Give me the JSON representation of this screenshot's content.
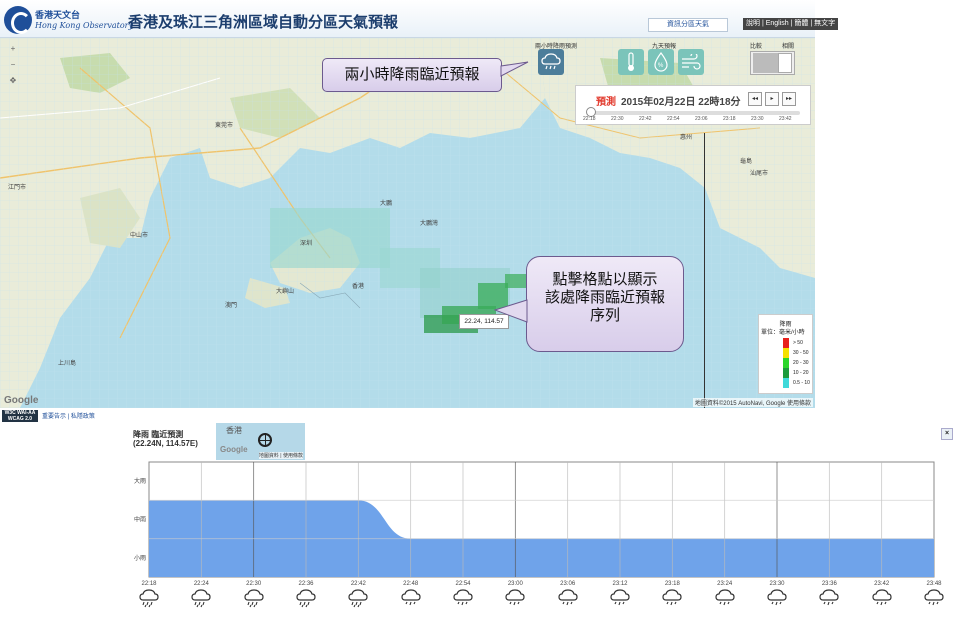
{
  "header": {
    "logo_cn": "香港天文台",
    "logo_en": "Hong Kong Observatory",
    "title": "香港及珠江三角洲區域自動分區天氣預報",
    "top_link": "資訊分區天氣",
    "languages": "說明 | English | 簡體 | 無文字"
  },
  "modes": {
    "rain_label": "兩小時降雨預測",
    "nine_day_label": "九天預報",
    "switch_label_1": "比較",
    "switch_label_2": "相關"
  },
  "time_panel": {
    "forecast_label": "預測",
    "datetime": "2015年02月22日 22時18分",
    "buttons": [
      "◂◂",
      "▸",
      "▸▸"
    ],
    "ticks": [
      "22:18",
      "22:30",
      "22:42",
      "22:54",
      "23:06",
      "23:18",
      "23:30",
      "23:42"
    ]
  },
  "map": {
    "places": [
      {
        "name": "江門市"
      },
      {
        "name": "中山市"
      },
      {
        "name": "東莞市"
      },
      {
        "name": "大鵬"
      },
      {
        "name": "深圳"
      },
      {
        "name": "大嶼山"
      },
      {
        "name": "香港"
      },
      {
        "name": "澳門"
      },
      {
        "name": "上川島"
      },
      {
        "name": "大鵬灣"
      },
      {
        "name": "惠州"
      },
      {
        "name": "龜島"
      },
      {
        "name": "汕尾市"
      }
    ],
    "attribution": "地圖資料©2015 AutoNavi, Google   使用條款",
    "google": "Google",
    "coord_popup": "22.24, 114.57"
  },
  "callouts": {
    "mode_callout": "兩小時降雨臨近預報",
    "grid_callout": [
      "點擊格點以顯示",
      "該處降雨臨近預報",
      "序列"
    ]
  },
  "legend": {
    "title": "降雨",
    "unit": "單位：毫米/小時",
    "items": [
      {
        "label": "> 50",
        "color": "#e8201b"
      },
      {
        "label": "30 - 50",
        "color": "#f5e100"
      },
      {
        "label": "20 - 30",
        "color": "#2bd62b"
      },
      {
        "label": "10 - 20",
        "color": "#1b9b3b"
      },
      {
        "label": "0.5 - 10",
        "color": "#3fd9d9"
      }
    ]
  },
  "footer": {
    "wcag": "W3C WAI-AA WCAG 2.0",
    "links": "重要告示 | 私隱政策"
  },
  "chart_panel": {
    "title_1": "降雨 臨近預測",
    "title_2": "(22.24N, 114.57E)",
    "mini_map_place": "香港",
    "mini_map_google": "Google",
    "mini_map_attr": "地圖資料 | 使用條款",
    "close": "×"
  },
  "chart_data": {
    "type": "area",
    "title": "",
    "xlabel": "",
    "ylabel": "",
    "y_categories": [
      "小雨",
      "中雨",
      "大雨"
    ],
    "ylim": [
      0,
      3
    ],
    "x": [
      "22:18",
      "22:24",
      "22:30",
      "22:36",
      "22:42",
      "22:48",
      "22:54",
      "23:00",
      "23:06",
      "23:12",
      "23:18",
      "23:24",
      "23:30",
      "23:36",
      "23:42",
      "23:48"
    ],
    "values": [
      2.0,
      2.0,
      2.0,
      2.0,
      2.0,
      1.0,
      1.0,
      1.0,
      1.0,
      1.0,
      1.0,
      1.0,
      1.0,
      1.0,
      1.0,
      1.0
    ],
    "series_color": "#6fa3ea",
    "grid": true,
    "weather_icons": [
      "rain",
      "rain",
      "rain",
      "rain",
      "rain",
      "drizzle",
      "drizzle",
      "drizzle",
      "drizzle",
      "drizzle",
      "drizzle",
      "drizzle",
      "drizzle",
      "drizzle",
      "drizzle",
      "drizzle"
    ]
  }
}
